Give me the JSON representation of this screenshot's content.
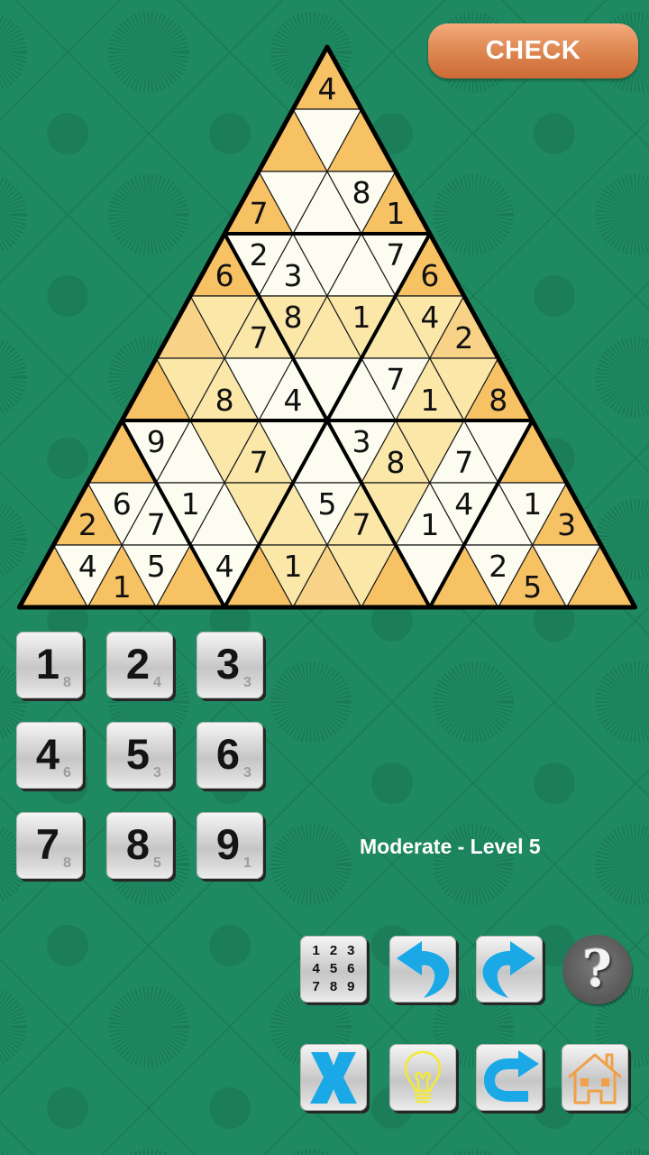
{
  "header": {
    "check_label": "CHECK"
  },
  "puzzle": {
    "palette": {
      "O": "#f6c263",
      "M": "#f8d286",
      "Y": "#fbe7a8",
      "W": "#fdfcf0"
    },
    "line_color": "#1a1a1a",
    "rows": [
      {
        "shades": [
          "O"
        ],
        "values": [
          "4"
        ]
      },
      {
        "shades": [
          "O",
          "W",
          "O"
        ],
        "values": [
          "",
          "",
          ""
        ]
      },
      {
        "shades": [
          "O",
          "W",
          "W",
          "W",
          "O"
        ],
        "values": [
          "7",
          "",
          "",
          "8",
          "1"
        ]
      },
      {
        "shades": [
          "O",
          "W",
          "W",
          "W",
          "W",
          "W",
          "O"
        ],
        "values": [
          "6",
          "2",
          "3",
          "",
          "",
          "7",
          "6"
        ]
      },
      {
        "shades": [
          "M",
          "Y",
          "Y",
          "Y",
          "Y",
          "Y",
          "Y",
          "Y",
          "M"
        ],
        "values": [
          "",
          "",
          "7",
          "8",
          "",
          "1",
          "",
          "4",
          "2"
        ]
      },
      {
        "shades": [
          "O",
          "Y",
          "Y",
          "W",
          "W",
          "W",
          "W",
          "W",
          "Y",
          "Y",
          "O"
        ],
        "values": [
          "",
          "",
          "8",
          "",
          "4",
          "",
          "",
          "7",
          "1",
          "",
          "8"
        ]
      },
      {
        "shades": [
          "O",
          "W",
          "W",
          "Y",
          "Y",
          "W",
          "W",
          "W",
          "Y",
          "Y",
          "W",
          "W",
          "O"
        ],
        "values": [
          "",
          "9",
          "",
          "",
          "7",
          "",
          "",
          "3",
          "8",
          "",
          "7",
          "",
          ""
        ]
      },
      {
        "shades": [
          "O",
          "W",
          "W",
          "W",
          "W",
          "Y",
          "Y",
          "W",
          "Y",
          "Y",
          "W",
          "W",
          "W",
          "W",
          "O"
        ],
        "values": [
          "2",
          "6",
          "7",
          "1",
          "",
          "",
          "",
          "5",
          "7",
          "",
          "1",
          "4",
          "",
          "1",
          "3"
        ]
      },
      {
        "shades": [
          "O",
          "W",
          "O",
          "W",
          "O",
          "W",
          "O",
          "Y",
          "M",
          "Y",
          "O",
          "W",
          "O",
          "W",
          "O",
          "W",
          "O"
        ],
        "values": [
          "",
          "4",
          "1",
          "5",
          "",
          "4",
          "",
          "1",
          "",
          "",
          "",
          "",
          "",
          "2",
          "5",
          "",
          ""
        ]
      }
    ]
  },
  "keypad": {
    "keys": [
      {
        "digit": "1",
        "count": "8"
      },
      {
        "digit": "2",
        "count": "4"
      },
      {
        "digit": "3",
        "count": "3"
      },
      {
        "digit": "4",
        "count": "6"
      },
      {
        "digit": "5",
        "count": "3"
      },
      {
        "digit": "6",
        "count": "3"
      },
      {
        "digit": "7",
        "count": "8"
      },
      {
        "digit": "8",
        "count": "5"
      },
      {
        "digit": "9",
        "count": "1"
      }
    ]
  },
  "status": {
    "level_text": "Moderate - Level 5"
  },
  "tools": {
    "notes": {
      "icon": "notes-grid-icon",
      "digits": [
        "1",
        "2",
        "3",
        "4",
        "5",
        "6",
        "7",
        "8",
        "9"
      ]
    },
    "undo": {
      "icon": "undo-arrow-icon",
      "color": "#1aa9e6"
    },
    "redo": {
      "icon": "redo-arrow-icon",
      "color": "#1aa9e6"
    },
    "help": {
      "icon": "help-icon",
      "glyph": "?"
    },
    "clear": {
      "icon": "x-icon",
      "color": "#1aa9e6"
    },
    "hint": {
      "icon": "lightbulb-icon",
      "color": "#f2e93a"
    },
    "restart": {
      "icon": "restart-arrow-icon",
      "color": "#1aa9e6"
    },
    "home": {
      "icon": "home-icon",
      "color": "#f0a048"
    }
  },
  "theme": {
    "background": "#1f8a62",
    "pattern": "#17744f",
    "check_button": "#e08a55"
  }
}
